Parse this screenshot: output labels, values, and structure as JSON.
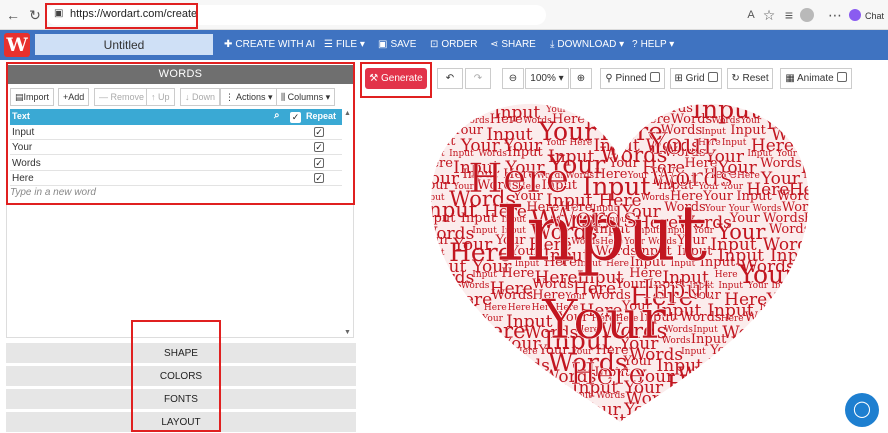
{
  "browser": {
    "url": "https://wordart.com/create",
    "profile_label": "Chat"
  },
  "app": {
    "logo_letter": "W",
    "title": "Untitled",
    "nav": {
      "create_ai": "CREATE WITH AI",
      "file": "FILE",
      "save": "SAVE",
      "order": "ORDER",
      "share": "SHARE",
      "download": "DOWNLOAD",
      "help": "HELP"
    }
  },
  "words_panel": {
    "header": "WORDS",
    "toolbar": {
      "import": "Import",
      "add": "Add",
      "remove": "Remove",
      "up": "Up",
      "down": "Down",
      "actions": "Actions",
      "columns": "Columns"
    },
    "columns": {
      "text": "Text",
      "repeat": "Repeat"
    },
    "rows": [
      {
        "text": "Input",
        "repeat": true
      },
      {
        "text": "Your",
        "repeat": true
      },
      {
        "text": "Words",
        "repeat": true
      },
      {
        "text": "Here",
        "repeat": true
      }
    ],
    "new_word_placeholder": "Type in a new word"
  },
  "sections": [
    "SHAPE",
    "COLORS",
    "FONTS",
    "LAYOUT"
  ],
  "canvas_toolbar": {
    "generate": "Generate",
    "zoom": "100%",
    "pinned": "Pinned",
    "grid": "Grid",
    "reset": "Reset",
    "animate": "Animate"
  },
  "colors": {
    "nav_blue": "#3f73c1",
    "word_red": "#c21620",
    "generate_red": "#e2334a",
    "table_header_blue": "#3aa9d4"
  }
}
